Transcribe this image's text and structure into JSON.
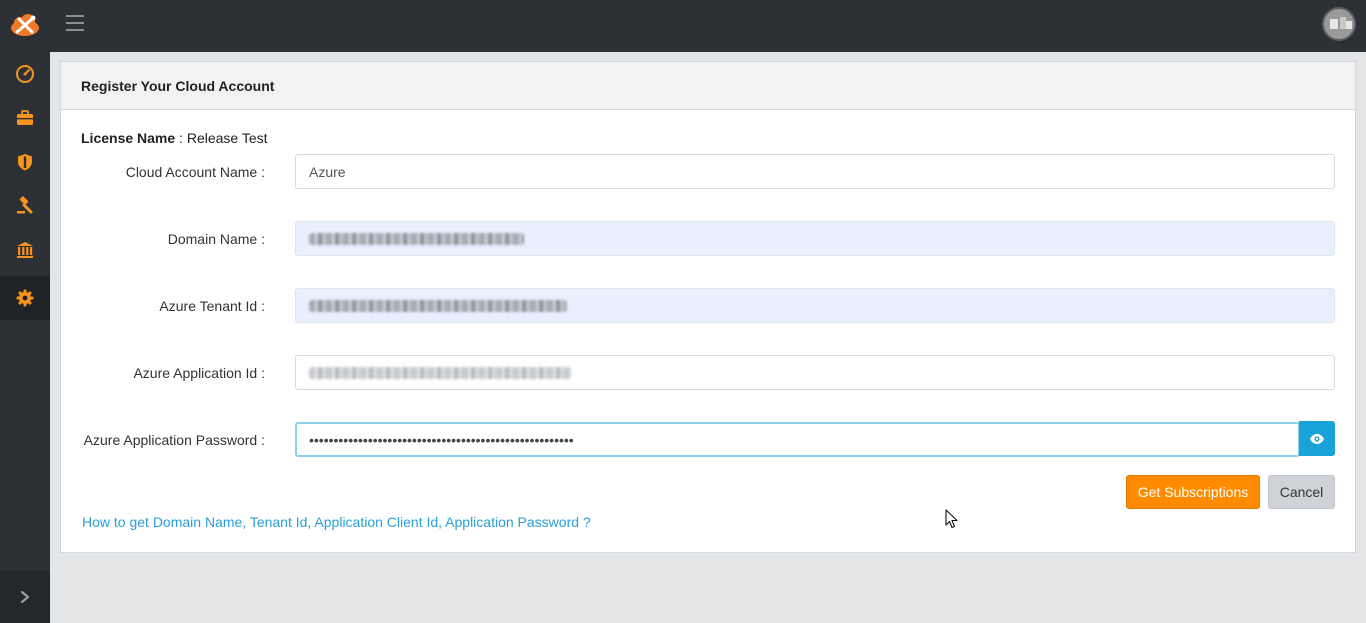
{
  "header": {
    "logo_icon": "cloud-tools-logo-icon",
    "menu_icon": "hamburger-icon",
    "avatar_icon": "user-avatar"
  },
  "sidebar": {
    "items": [
      {
        "icon": "dashboard-gauge-icon",
        "active": false
      },
      {
        "icon": "briefcase-icon",
        "active": false
      },
      {
        "icon": "shield-icon",
        "active": false
      },
      {
        "icon": "gavel-icon",
        "active": false
      },
      {
        "icon": "bank-icon",
        "active": false
      },
      {
        "icon": "gear-icon",
        "active": true
      }
    ],
    "expand_icon": "chevron-right-icon"
  },
  "card": {
    "title": "Register Your Cloud Account",
    "license_label": "License Name",
    "license_sep": " : ",
    "license_value": "Release Test"
  },
  "form": {
    "cloud_account_name": {
      "label": "Cloud Account Name :",
      "value": "Azure"
    },
    "domain_name": {
      "label": "Domain Name :"
    },
    "tenant_id": {
      "label": "Azure Tenant Id :"
    },
    "application_id": {
      "label": "Azure Application Id :"
    },
    "application_password": {
      "label": "Azure Application Password :",
      "value": "••••••••••••••••••••••••••••••••••••••••••••••••••••••"
    }
  },
  "buttons": {
    "get_subscriptions": "Get Subscriptions",
    "cancel": "Cancel",
    "show_password_icon": "eye-icon"
  },
  "help_link": "How to get Domain Name, Tenant Id, Application Client Id, Application Password ?",
  "colors": {
    "accent": "#ff8c00",
    "topbar": "#2d3035",
    "info_button": "#1aa3d9",
    "link": "#2a9fd6"
  }
}
